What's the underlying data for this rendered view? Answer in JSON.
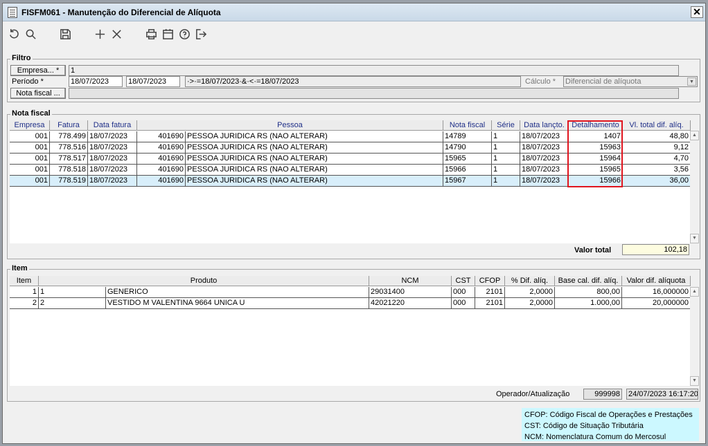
{
  "window": {
    "title": "FISFM061 - Manutenção do Diferencial de Alíquota",
    "close_label": "✕"
  },
  "toolbar": [
    {
      "name": "refresh-icon"
    },
    {
      "name": "search-icon"
    },
    {
      "name": "save-icon"
    },
    {
      "name": "add-icon"
    },
    {
      "name": "delete-icon"
    },
    {
      "name": "print-icon"
    },
    {
      "name": "calendar-icon"
    },
    {
      "name": "help-icon"
    },
    {
      "name": "exit-icon"
    }
  ],
  "filtro": {
    "label": "Filtro",
    "empresa_button": "Empresa... *",
    "empresa_value": "1",
    "periodo_label": "Período *",
    "periodo_inicio": "18/07/2023",
    "periodo_fim": "18/07/2023",
    "periodo_expr": "·>·=18/07/2023·&·<·=18/07/2023",
    "calculo_label": "Cálculo *",
    "calculo_value": "Diferencial de alíquota",
    "nota_fiscal_button": "Nota fiscal ...",
    "nota_fiscal_value": ""
  },
  "nota_fiscal": {
    "label": "Nota fiscal",
    "columns": [
      "Empresa",
      "Fatura",
      "Data fatura",
      "Pessoa",
      "Nota fiscal",
      "Série",
      "Data lançto.",
      "Detalhamento",
      "Vl. total dif. alíq."
    ],
    "rows": [
      [
        "001",
        "778.499",
        "18/07/2023",
        "401690",
        "PESSOA JURIDICA RS (NAO ALTERAR)",
        "14789",
        "1",
        "18/07/2023",
        "1407",
        "48,80"
      ],
      [
        "001",
        "778.516",
        "18/07/2023",
        "401690",
        "PESSOA JURIDICA RS (NAO ALTERAR)",
        "14790",
        "1",
        "18/07/2023",
        "15963",
        "9,12"
      ],
      [
        "001",
        "778.517",
        "18/07/2023",
        "401690",
        "PESSOA JURIDICA RS (NAO ALTERAR)",
        "15965",
        "1",
        "18/07/2023",
        "15964",
        "4,70"
      ],
      [
        "001",
        "778.518",
        "18/07/2023",
        "401690",
        "PESSOA JURIDICA RS (NAO ALTERAR)",
        "15966",
        "1",
        "18/07/2023",
        "15965",
        "3,56"
      ],
      [
        "001",
        "778.519",
        "18/07/2023",
        "401690",
        "PESSOA JURIDICA RS (NAO ALTERAR)",
        "15967",
        "1",
        "18/07/2023",
        "15966",
        "36,00"
      ]
    ],
    "valor_total_label": "Valor total",
    "valor_total": "102,18"
  },
  "item": {
    "label": "Item",
    "columns": [
      "Item",
      "Produto",
      "NCM",
      "CST",
      "CFOP",
      "% Dif. alíq.",
      "Base cal. dif. alíq.",
      "Valor dif. alíquota"
    ],
    "rows": [
      [
        "1",
        "1",
        "GENERICO",
        "29031400",
        "000",
        "2101",
        "2,0000",
        "800,00",
        "16,000000"
      ],
      [
        "2",
        "2",
        "VESTIDO M VALENTINA 9664 UNICA U",
        "42021220",
        "000",
        "2101",
        "2,0000",
        "1.000,00",
        "20,000000"
      ]
    ],
    "operador_label": "Operador/Atualização",
    "operador": "999998",
    "atualizacao": "24/07/2023 16:17:20"
  },
  "legend": [
    "CFOP: Código Fiscal de Operações e Prestações",
    "CST: Código de Situação Tributária",
    "NCM: Nomenclatura Comum do Mercosul"
  ]
}
